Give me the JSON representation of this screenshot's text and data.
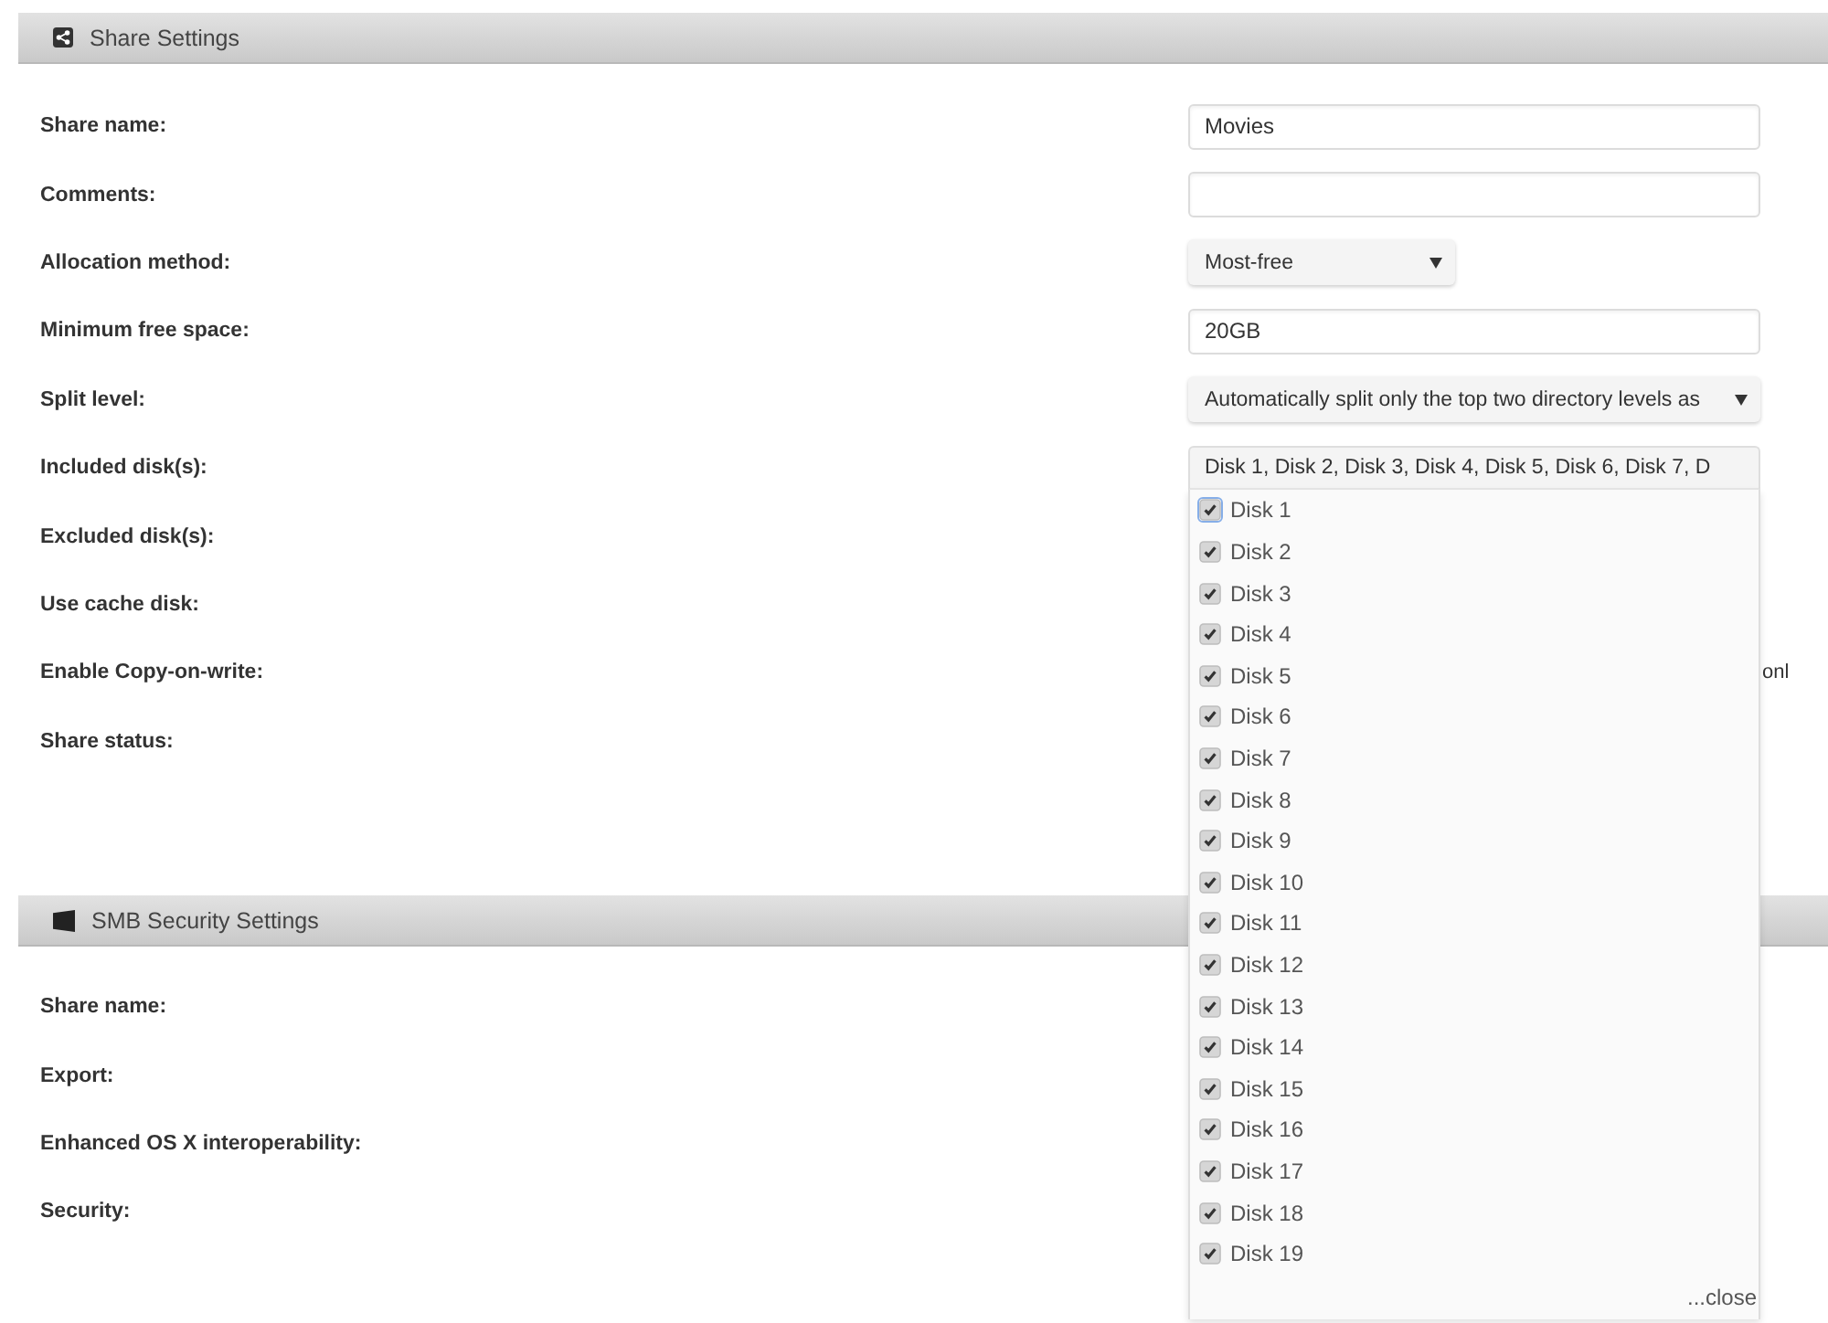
{
  "sections": [
    {
      "title": "Share Settings",
      "fields": [
        {
          "label": "Share name:",
          "kind": "text",
          "value": "Movies"
        },
        {
          "label": "Comments:",
          "kind": "text"
        },
        {
          "label": "Allocation method:",
          "kind": "dropdown",
          "value": "Most-free"
        },
        {
          "label": "Minimum free space:",
          "kind": "text",
          "value": "20GB"
        },
        {
          "label": "Split level:",
          "kind": "select",
          "value": "Automatically split only the top two directory levels as"
        },
        {
          "label": "Included disk(s):",
          "kind": "multiselect",
          "value": "Disk 1, Disk 2, Disk 3, Disk 4, Disk 5, Disk 6, Disk 7, D",
          "expanded": true,
          "close_label": "...close",
          "options": [
            {
              "label": "Disk 1",
              "checked": true,
              "focused": true
            },
            {
              "label": "Disk 2",
              "checked": true,
              "focused": false
            },
            {
              "label": "Disk 3",
              "checked": true,
              "focused": false
            },
            {
              "label": "Disk 4",
              "checked": true,
              "focused": false
            },
            {
              "label": "Disk 5",
              "checked": true,
              "focused": false
            },
            {
              "label": "Disk 6",
              "checked": true,
              "focused": false
            },
            {
              "label": "Disk 7",
              "checked": true,
              "focused": false
            },
            {
              "label": "Disk 8",
              "checked": true,
              "focused": false
            },
            {
              "label": "Disk 9",
              "checked": true,
              "focused": false
            },
            {
              "label": "Disk 10",
              "checked": true,
              "focused": false
            },
            {
              "label": "Disk 11",
              "checked": true,
              "focused": false
            },
            {
              "label": "Disk 12",
              "checked": true,
              "focused": false
            },
            {
              "label": "Disk 13",
              "checked": true,
              "focused": false
            },
            {
              "label": "Disk 14",
              "checked": true,
              "focused": false
            },
            {
              "label": "Disk 15",
              "checked": true,
              "focused": false
            },
            {
              "label": "Disk 16",
              "checked": true,
              "focused": false
            },
            {
              "label": "Disk 17",
              "checked": true,
              "focused": false
            },
            {
              "label": "Disk 18",
              "checked": true,
              "focused": false
            },
            {
              "label": "Disk 19",
              "checked": true,
              "focused": false
            }
          ]
        },
        {
          "label": "Excluded disk(s):"
        },
        {
          "label": "Use cache disk:"
        },
        {
          "label": "Enable Copy-on-write:",
          "kind": "partial",
          "value": "onl"
        },
        {
          "label": "Share status:"
        }
      ]
    },
    {
      "title": "SMB Security Settings",
      "fields": [
        {
          "label": "Share name:"
        },
        {
          "label": "Export:"
        },
        {
          "label": "Enhanced OS X interoperability:"
        },
        {
          "label": "Security:"
        }
      ]
    }
  ]
}
